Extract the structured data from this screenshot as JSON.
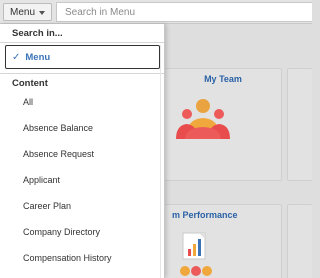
{
  "topbar": {
    "menu_label": "Menu",
    "search_placeholder": "Search in Menu"
  },
  "tiles": {
    "my_team": "My Team",
    "team_performance": "m Performance"
  },
  "dropdown": {
    "search_in_label": "Search in...",
    "selected_option": "Menu",
    "content_header": "Content",
    "items": [
      "All",
      "Absence Balance",
      "Absence Request",
      "Applicant",
      "Career Plan",
      "Company Directory",
      "Compensation History"
    ]
  },
  "colors": {
    "accent": "#3b73b9",
    "tile_title": "#2b62a6"
  },
  "icons": {
    "menu_chevron": "chevron-down-icon",
    "selected_marker": "checkmark-icon",
    "team_tile": "team-people-icon",
    "performance_tile": "performance-chart-icon"
  }
}
